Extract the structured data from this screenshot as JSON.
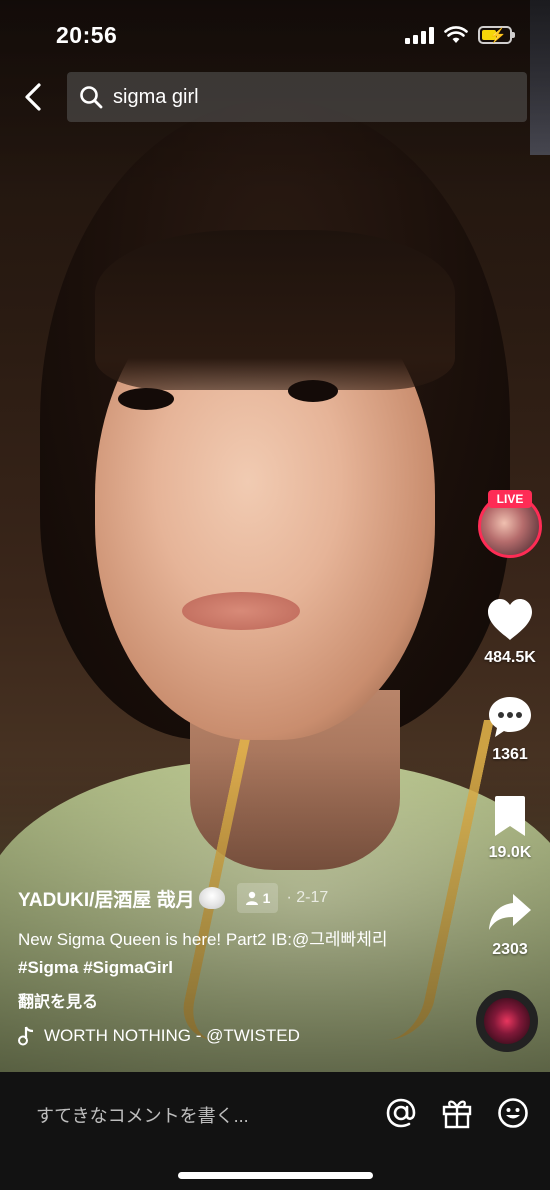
{
  "status_bar": {
    "time": "20:56"
  },
  "search": {
    "query": "sigma girl"
  },
  "rail": {
    "live_label": "LIVE",
    "likes": "484.5K",
    "comments": "1361",
    "bookmarks": "19.0K",
    "shares": "2303"
  },
  "post": {
    "author": "YADUKI/居酒屋 哉月",
    "friends_count": "1",
    "date": "· 2-17",
    "description_text": "New Sigma Queen is here! Part2 IB:@그레빠체리",
    "hashtags": [
      "#Sigma",
      "#SigmaGirl"
    ],
    "translate_label": "翻訳を見る",
    "music": "WORTH NOTHING - @TWISTED"
  },
  "bottom_bar": {
    "comment_placeholder": "すてきなコメントを書く..."
  },
  "colors": {
    "live_red": "#fe2c55",
    "battery_yellow": "#f5d60a"
  }
}
